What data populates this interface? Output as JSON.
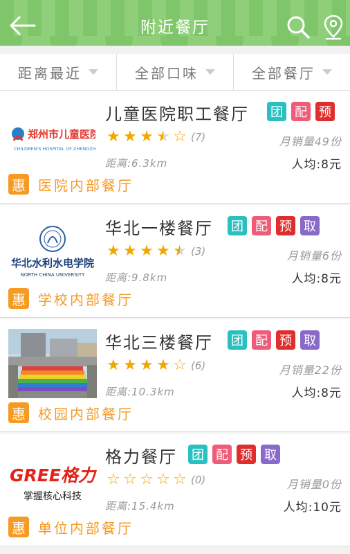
{
  "header": {
    "title": "附近餐厅",
    "back_icon": "back-arrow-icon",
    "search_icon": "search-icon",
    "location_icon": "location-pin-icon"
  },
  "filters": [
    {
      "label": "距离最近"
    },
    {
      "label": "全部口味"
    },
    {
      "label": "全部餐厅"
    }
  ],
  "colors": {
    "header_green": "#7fc56a",
    "promo_orange": "#f59a22",
    "star": "#f0a800",
    "tag_tuan": "#2bc0c0",
    "tag_pei": "#ef5b78",
    "tag_yu": "#e02d2d",
    "tag_qu": "#8a6ac9"
  },
  "restaurants": [
    {
      "name": "儿童医院职工餐厅",
      "logo_text": "郑州市儿童医院",
      "logo_sub": "CHILDREN'S HOSPITAL OF ZHENGZHOU",
      "tags": [
        "团",
        "配",
        "预"
      ],
      "rating": 3.5,
      "reviews": "(7)",
      "sales": "月销量49份",
      "distance": "距离:6.3km",
      "avg": "人均:8元",
      "promo_badge": "惠",
      "promo": "医院内部餐厅"
    },
    {
      "name": "华北一楼餐厅",
      "logo_text": "华北水利水电学院",
      "logo_sub": "NORTH CHINA UNIVERSITY",
      "tags": [
        "团",
        "配",
        "预",
        "取"
      ],
      "rating": 4.5,
      "reviews": "(3)",
      "sales": "月销量6份",
      "distance": "距离:9.8km",
      "avg": "人均:8元",
      "promo_badge": "惠",
      "promo": "学校内部餐厅"
    },
    {
      "name": "华北三楼餐厅",
      "logo_text": "",
      "logo_sub": "",
      "tags": [
        "团",
        "配",
        "预",
        "取"
      ],
      "rating": 4,
      "reviews": "(6)",
      "sales": "月销量22份",
      "distance": "距离:10.3km",
      "avg": "人均:8元",
      "promo_badge": "惠",
      "promo": "校园内部餐厅"
    },
    {
      "name": "格力餐厅",
      "logo_text": "GREE格力",
      "logo_sub": "掌握核心科技",
      "tags": [
        "团",
        "配",
        "预",
        "取"
      ],
      "rating": 0,
      "reviews": "(0)",
      "sales": "月销量0份",
      "distance": "距离:15.4km",
      "avg": "人均:10元",
      "promo_badge": "惠",
      "promo": "单位内部餐厅"
    }
  ]
}
